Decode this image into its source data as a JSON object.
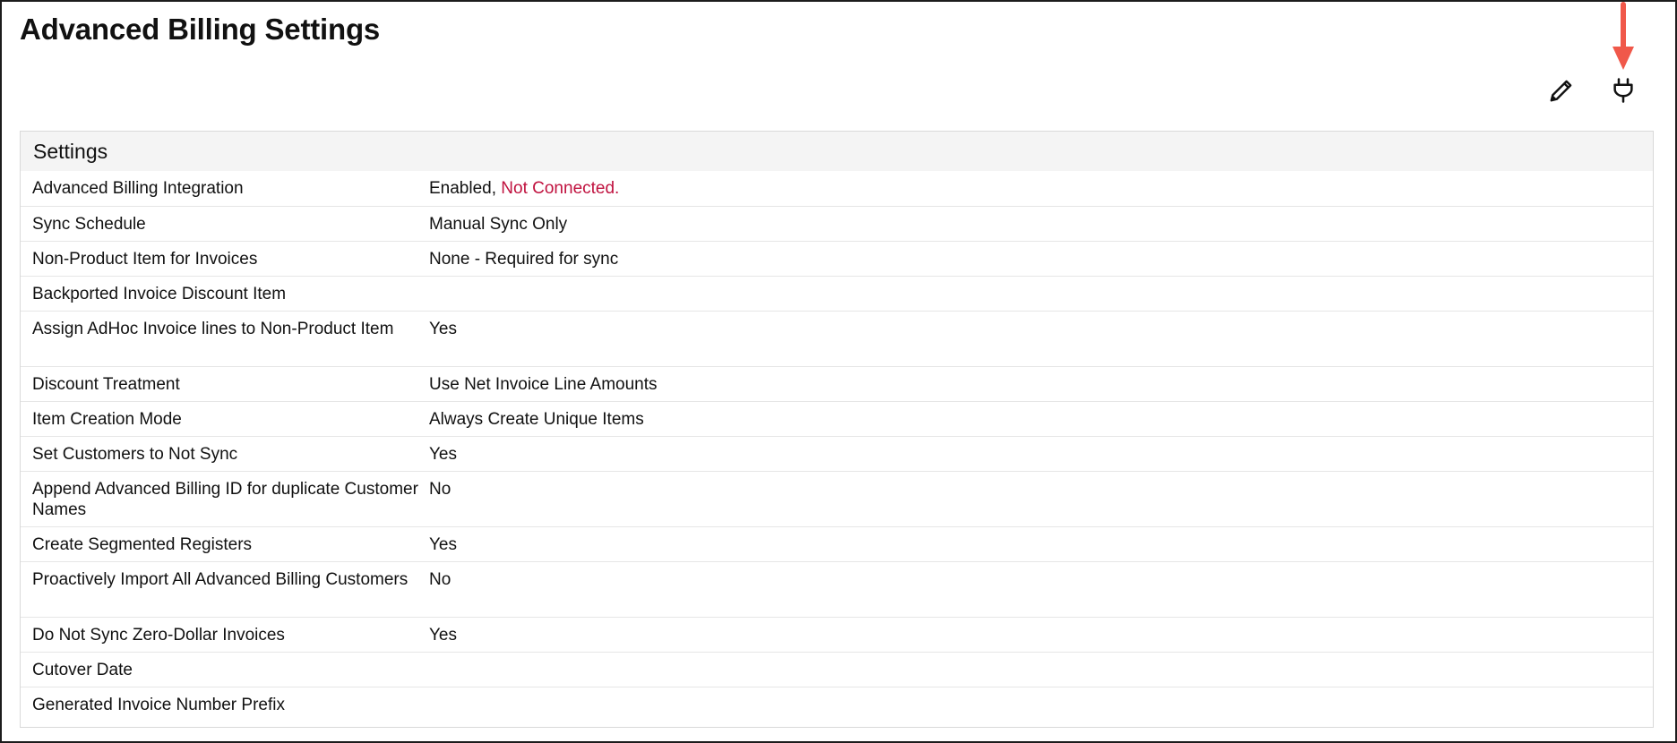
{
  "page": {
    "title": "Advanced Billing Settings"
  },
  "toolbar": {
    "edit_icon": "pencil-icon",
    "connect_icon": "plug-icon"
  },
  "colors": {
    "alert": "#c0123f",
    "arrow": "#f0584a"
  },
  "settings": {
    "header": "Settings",
    "rows": [
      {
        "label": "Advanced Billing Integration",
        "value": "Enabled, ",
        "value_alert": "Not Connected."
      },
      {
        "label": "Sync Schedule",
        "value": "Manual Sync Only"
      },
      {
        "label": "Non-Product Item for Invoices",
        "value_alert": "None - Required for sync"
      },
      {
        "label": "Backported Invoice Discount Item",
        "value": ""
      },
      {
        "label": "Assign AdHoc Invoice lines to Non-Product Item",
        "value": "Yes"
      },
      {
        "label": "Discount Treatment",
        "value": "Use Net Invoice Line Amounts"
      },
      {
        "label": "Item Creation Mode",
        "value": "Always Create Unique Items"
      },
      {
        "label": "Set Customers to Not Sync",
        "value": "Yes"
      },
      {
        "label": "Append Advanced Billing ID for duplicate Customer Names",
        "value": "No"
      },
      {
        "label": "Create Segmented Registers",
        "value": "Yes"
      },
      {
        "label": "Proactively Import All Advanced Billing Customers",
        "value": "No"
      },
      {
        "label": "Do Not Sync Zero-Dollar Invoices",
        "value": "Yes"
      },
      {
        "label": "Cutover Date",
        "value": ""
      },
      {
        "label": "Generated Invoice Number Prefix",
        "value": ""
      }
    ]
  }
}
